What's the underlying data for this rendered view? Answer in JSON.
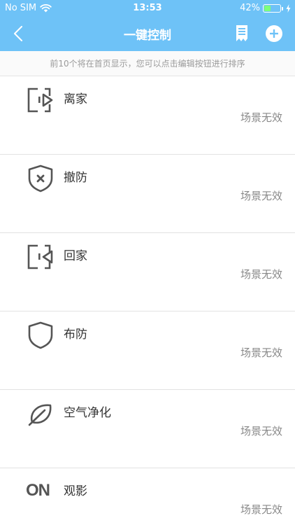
{
  "status_bar": {
    "carrier": "No SIM",
    "time": "13:53",
    "battery_percent": "42%",
    "battery_level": 0.42
  },
  "nav": {
    "title": "一键控制",
    "back_icon": "chevron-left-icon",
    "list_icon": "document-list-icon",
    "add_icon": "plus-circle-icon"
  },
  "hint": "前10个将在首页显示，您可以点击编辑按钮进行排序",
  "scenes": [
    {
      "name": "离家",
      "status": "场景无效",
      "icon": "leave-home-icon"
    },
    {
      "name": "撤防",
      "status": "场景无效",
      "icon": "shield-x-icon"
    },
    {
      "name": "回家",
      "status": "场景无效",
      "icon": "return-home-icon"
    },
    {
      "name": "布防",
      "status": "场景无效",
      "icon": "shield-icon"
    },
    {
      "name": "空气净化",
      "status": "场景无效",
      "icon": "leaf-icon"
    },
    {
      "name": "观影",
      "status": "场景无效",
      "icon": "on-icon",
      "icon_text": "ON"
    }
  ],
  "colors": {
    "header_bg": "#6ec2f7",
    "icon": "#555555",
    "status_text": "#888888"
  }
}
